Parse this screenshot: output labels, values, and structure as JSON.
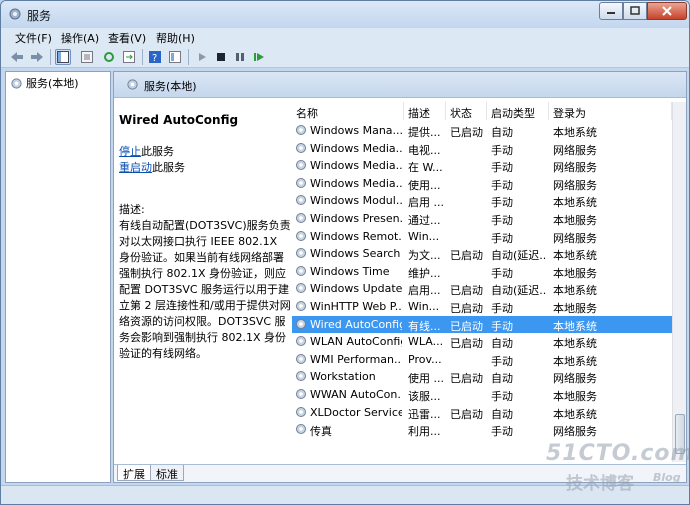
{
  "window": {
    "title": "服务",
    "colors": {
      "selection": "#3b97f0",
      "link": "#0b4fb3",
      "close_button": "#c7432a"
    }
  },
  "menu": [
    "文件(F)",
    "操作(A)",
    "查看(V)",
    "帮助(H)"
  ],
  "toolbar": {
    "icons": [
      "back-arrow-icon",
      "forward-arrow-icon",
      "show-hide-tree-icon",
      "properties-icon",
      "refresh-icon",
      "export-icon",
      "help-icon",
      "view-icon",
      "start-service-icon",
      "stop-service-icon",
      "pause-service-icon",
      "restart-service-icon"
    ]
  },
  "tree": {
    "root_label": "服务(本地)"
  },
  "panel": {
    "header": "服务(本地)"
  },
  "details": {
    "service_name": "Wired AutoConfig",
    "stop_link": "停止",
    "stop_suffix": "此服务",
    "restart_link": "重启动",
    "restart_suffix": "此服务",
    "description_label": "描述:",
    "description": "有线自动配置(DOT3SVC)服务负责对以太网接口执行 IEEE 802.1X 身份验证。如果当前有线网络部署强制执行 802.1X 身份验证，则应配置 DOT3SVC 服务运行以用于建立第 2 层连接性和/或用于提供对网络资源的访问权限。DOT3SVC 服务会影响到强制执行 802.1X 身份验证的有线网络。"
  },
  "columns": [
    "名称",
    "描述",
    "状态",
    "启动类型",
    "登录为"
  ],
  "services": [
    {
      "name": "Windows Mana...",
      "desc": "提供...",
      "status": "已启动",
      "startup": "自动",
      "logon": "本地系统"
    },
    {
      "name": "Windows Media...",
      "desc": "电视...",
      "status": "",
      "startup": "手动",
      "logon": "网络服务"
    },
    {
      "name": "Windows Media...",
      "desc": "在 W...",
      "status": "",
      "startup": "手动",
      "logon": "网络服务"
    },
    {
      "name": "Windows Media...",
      "desc": "使用...",
      "status": "",
      "startup": "手动",
      "logon": "网络服务"
    },
    {
      "name": "Windows Modul...",
      "desc": "启用 ...",
      "status": "",
      "startup": "手动",
      "logon": "本地系统"
    },
    {
      "name": "Windows Presen...",
      "desc": "通过...",
      "status": "",
      "startup": "手动",
      "logon": "本地服务"
    },
    {
      "name": "Windows Remot...",
      "desc": "Win...",
      "status": "",
      "startup": "手动",
      "logon": "网络服务"
    },
    {
      "name": "Windows Search",
      "desc": "为文...",
      "status": "已启动",
      "startup": "自动(延迟...",
      "logon": "本地系统"
    },
    {
      "name": "Windows Time",
      "desc": "维护...",
      "status": "",
      "startup": "手动",
      "logon": "本地服务"
    },
    {
      "name": "Windows Update",
      "desc": "启用...",
      "status": "已启动",
      "startup": "自动(延迟...",
      "logon": "本地系统"
    },
    {
      "name": "WinHTTP Web P...",
      "desc": "Win...",
      "status": "已启动",
      "startup": "手动",
      "logon": "本地服务"
    },
    {
      "name": "Wired AutoConfig",
      "desc": "有线...",
      "status": "已启动",
      "startup": "手动",
      "logon": "本地系统",
      "selected": true
    },
    {
      "name": "WLAN AutoConfig",
      "desc": "WLA...",
      "status": "已启动",
      "startup": "自动",
      "logon": "本地系统"
    },
    {
      "name": "WMI Performan...",
      "desc": "Prov...",
      "status": "",
      "startup": "手动",
      "logon": "本地系统"
    },
    {
      "name": "Workstation",
      "desc": "使用 ...",
      "status": "已启动",
      "startup": "自动",
      "logon": "网络服务"
    },
    {
      "name": "WWAN AutoCon...",
      "desc": "该服...",
      "status": "",
      "startup": "手动",
      "logon": "本地服务"
    },
    {
      "name": "XLDoctor Service",
      "desc": "迅雷...",
      "status": "已启动",
      "startup": "自动",
      "logon": "本地系统"
    },
    {
      "name": "传真",
      "desc": "利用...",
      "status": "",
      "startup": "手动",
      "logon": "网络服务"
    }
  ],
  "tabs": [
    "扩展",
    "标准"
  ],
  "watermark": {
    "line1": "51CTO.com",
    "line2": "技术博客",
    "line3": "Blog"
  }
}
